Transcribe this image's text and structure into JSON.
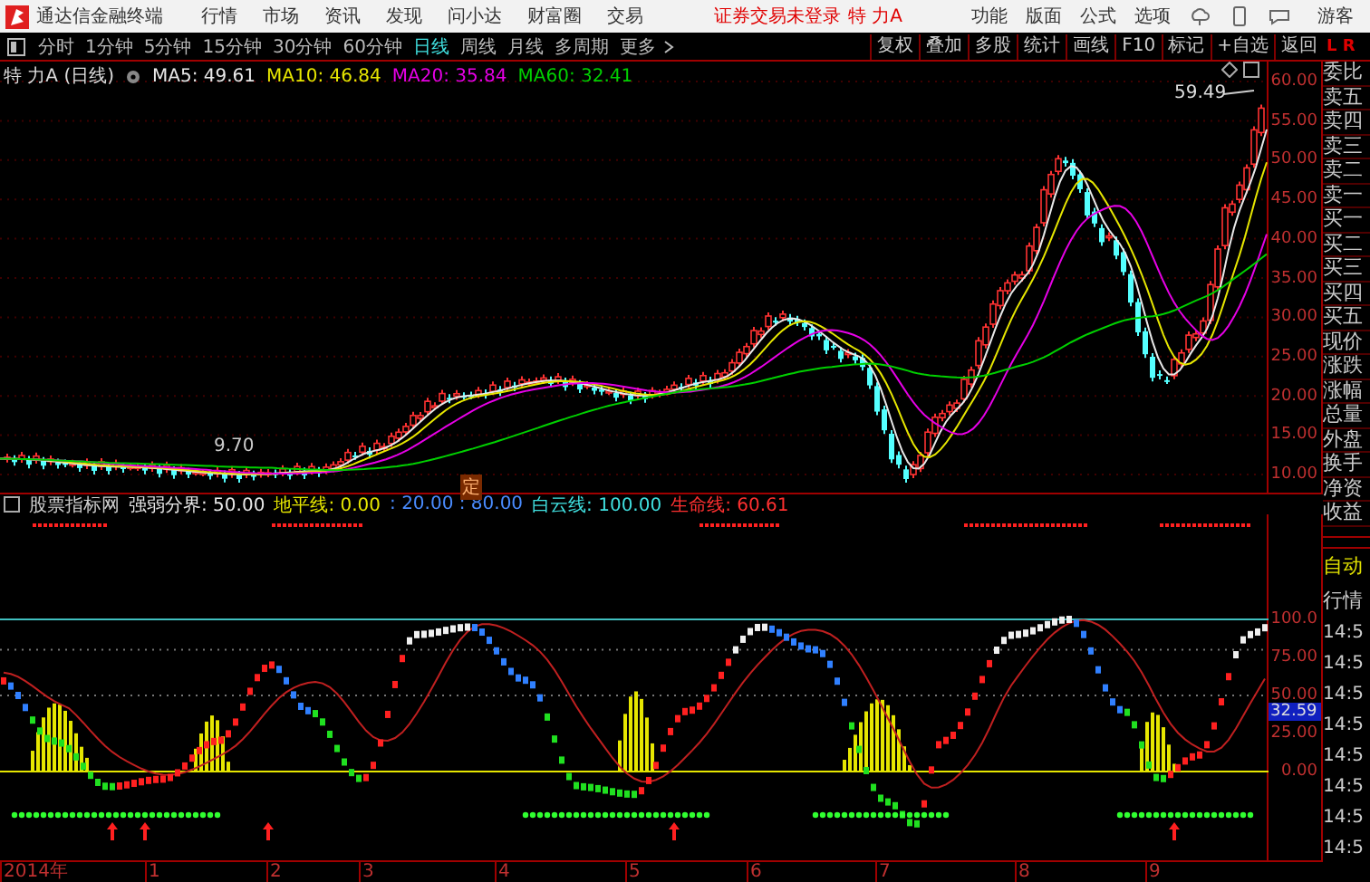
{
  "menu_bar": {
    "app_name": "通达信金融终端",
    "items": [
      "行情",
      "市场",
      "资讯",
      "发现",
      "问小达",
      "财富圈",
      "交易"
    ],
    "notice": "证券交易未登录",
    "stock": "特 力A",
    "right_items": [
      "功能",
      "版面",
      "公式",
      "选项"
    ],
    "user": "游客"
  },
  "toolbar": {
    "periods": [
      {
        "label": "分时",
        "selected": false
      },
      {
        "label": "1分钟",
        "selected": false
      },
      {
        "label": "5分钟",
        "selected": false
      },
      {
        "label": "15分钟",
        "selected": false
      },
      {
        "label": "30分钟",
        "selected": false
      },
      {
        "label": "60分钟",
        "selected": false
      },
      {
        "label": "日线",
        "selected": true
      },
      {
        "label": "周线",
        "selected": false
      },
      {
        "label": "月线",
        "selected": false
      },
      {
        "label": "多周期",
        "selected": false
      },
      {
        "label": "更多",
        "selected": false
      }
    ],
    "tools": [
      "复权",
      "叠加",
      "多股",
      "统计",
      "画线",
      "F10",
      "标记",
      "+自选",
      "返回"
    ]
  },
  "main_chart": {
    "title": "特 力A (日线)",
    "ma": [
      {
        "label": "MA5: 49.61",
        "color": "#e8e8e8"
      },
      {
        "label": "MA10: 46.84",
        "color": "#e6e600"
      },
      {
        "label": "MA20: 35.84",
        "color": "#e600e6"
      },
      {
        "label": "MA60: 32.41",
        "color": "#00d000"
      }
    ],
    "high_label": "59.49",
    "low_label": "9.70",
    "marker": "定",
    "price_axis": [
      "60.00",
      "55.00",
      "50.00",
      "45.00",
      "40.00",
      "35.00",
      "30.00",
      "25.00",
      "20.00",
      "15.00",
      "10.00"
    ]
  },
  "indicator": {
    "legend": [
      {
        "label": "股票指标网",
        "color": "#d0d0d0"
      },
      {
        "label": "强弱分界: 50.00",
        "color": "#e8e8e8"
      },
      {
        "label": "地平线: 0.00",
        "color": "#e6e600"
      },
      {
        "label": ": 20.00 : 80.00",
        "color": "#4a8cff"
      },
      {
        "label": "白云线: 100.00",
        "color": "#40e0e0"
      },
      {
        "label": "生命线: 60.61",
        "color": "#ff3030"
      }
    ],
    "axis": [
      "100.0",
      "75.00",
      "50.00",
      "25.00",
      "0.00"
    ],
    "current": "32.59"
  },
  "x_axis": [
    "2014年",
    "1",
    "2",
    "3",
    "4",
    "5",
    "6",
    "7",
    "8",
    "9"
  ],
  "side_panel": {
    "badge": "L R",
    "quote_labels": [
      "委比",
      "卖五",
      "卖四",
      "卖三",
      "卖二",
      "卖一",
      "买一",
      "买二",
      "买三",
      "买四",
      "买五",
      "现价",
      "涨跌",
      "涨幅",
      "总量",
      "外盘",
      "换手",
      "净资",
      "收益"
    ],
    "mode_labels": [
      "自动",
      "行情"
    ],
    "times": [
      "14:5",
      "14:5",
      "14:5",
      "14:5",
      "14:5",
      "14:5",
      "14:5",
      "14:5"
    ]
  }
}
